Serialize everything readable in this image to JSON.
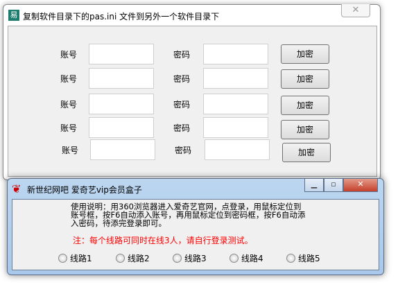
{
  "window1": {
    "title": "复制软件目录下的pas.ini 文件到另外一个软件目录下",
    "close": "✕",
    "rows": [
      {
        "account_label": "账号",
        "password_label": "密码",
        "button": "加密"
      },
      {
        "account_label": "账号",
        "password_label": "密码",
        "button": "加密"
      },
      {
        "account_label": "账号",
        "password_label": "密码",
        "button": "加密"
      },
      {
        "account_label": "账号",
        "password_label": "密码",
        "button": "加密"
      },
      {
        "account_label": "账号",
        "password_label": "密码",
        "button": "加密"
      }
    ]
  },
  "window2": {
    "title": "新世纪网吧 爱奇艺vip会员盒子",
    "instructions": "使用说明：用360浏览器进入爱奇艺官网，点登录，用鼠标定位到账号框，按F6自动添入账号，再用鼠标定位到密码框，按F6自动添入密码，待添完登录即可。",
    "note": "注：每个线路可同时在线3人，请自行登录测试。",
    "lines": [
      "线路1",
      "线路2",
      "线路3",
      "线路4",
      "线路5"
    ]
  }
}
